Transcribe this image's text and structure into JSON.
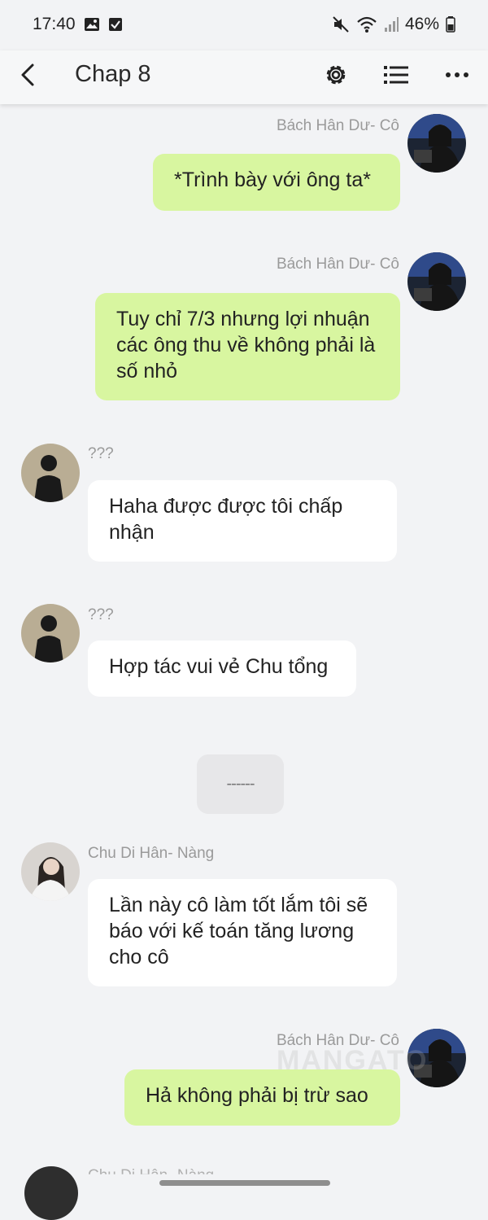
{
  "status": {
    "time": "17:40",
    "battery": "46%",
    "icons": [
      "gallery-icon",
      "checkbox-icon",
      "mute-icon",
      "wifi-icon",
      "signal-icon",
      "battery-icon"
    ]
  },
  "appbar": {
    "title": "Chap 8",
    "icons": [
      "back-icon",
      "gear-icon",
      "list-icon",
      "more-icon"
    ]
  },
  "messages": [
    {
      "sender": "Bách Hân Dư- Cô",
      "side": "right",
      "text": "*Trình bày với ông ta*"
    },
    {
      "sender": "Bách Hân Dư- Cô",
      "side": "right",
      "text": "Tuy chỉ 7/3 nhưng lợi nhuận các ông thu về không phải là số nhỏ"
    },
    {
      "sender": "???",
      "side": "left",
      "text": "Haha được được tôi chấp nhận"
    },
    {
      "sender": "???",
      "side": "left",
      "text": "Hợp tác vui vẻ Chu tổng"
    },
    {
      "sender": "Chu Di Hân- Nàng",
      "side": "left",
      "text": "Lần này cô làm tốt lắm tôi sẽ báo với kế toán tăng lương cho cô"
    },
    {
      "sender": "Bách Hân Dư- Cô",
      "side": "right",
      "text": "Hả không phải bị trừ sao"
    }
  ],
  "divider": "------",
  "partial_sender": "Chu Di Hân- Nàng",
  "watermark": "MANGATO",
  "colors": {
    "background": "#f2f3f5",
    "bubble_self": "#d8f6a0",
    "bubble_other": "#ffffff",
    "name": "#9a9a9a"
  }
}
